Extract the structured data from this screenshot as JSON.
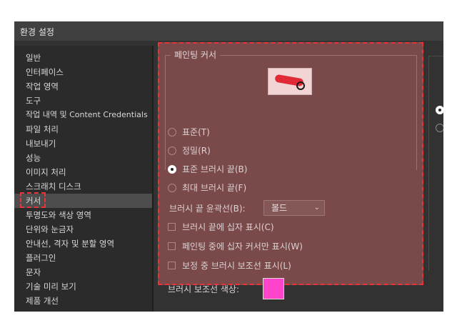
{
  "window": {
    "title": "환경 설정"
  },
  "sidebar": {
    "items": [
      {
        "label": "일반"
      },
      {
        "label": "인터페이스"
      },
      {
        "label": "작업 영역"
      },
      {
        "label": "도구"
      },
      {
        "label": "작업 내역 및 Content Credentials"
      },
      {
        "label": "파일 처리"
      },
      {
        "label": "내보내기"
      },
      {
        "label": "성능"
      },
      {
        "label": "이미지 처리"
      },
      {
        "label": "스크래치 디스크"
      },
      {
        "label": "커서",
        "selected": true
      },
      {
        "label": "투명도와 색상 영역"
      },
      {
        "label": "단위와 눈금자"
      },
      {
        "label": "안내선, 격자 및 분할 영역"
      },
      {
        "label": "플러그인"
      },
      {
        "label": "문자"
      },
      {
        "label": "기술 미리 보기"
      },
      {
        "label": "제품 개선"
      }
    ]
  },
  "painting_cursor": {
    "group_title": "페인팅 커서",
    "options": [
      {
        "label": "표준(T)",
        "checked": false
      },
      {
        "label": "정밀(R)",
        "checked": false
      },
      {
        "label": "표준 브러시 끝(B)",
        "checked": true
      },
      {
        "label": "최대 브러시 끝(F)",
        "checked": false
      }
    ],
    "outline_label": "브러시 끝 윤곽선(B):",
    "outline_value": "볼드",
    "checkboxes": [
      {
        "label": "브러시 끝에 십자 표시(C)",
        "checked": false
      },
      {
        "label": "페인팅 중에 십자 커서만 표시(W)",
        "checked": false
      },
      {
        "label": "보정 중 브러시 보조선 표시(L)",
        "checked": false
      }
    ],
    "guide_color_label": "브러시 보조선 색상:",
    "guide_color": "#ff44cc",
    "preview_icon": "brush-cursor-preview-icon"
  },
  "colors": {
    "highlight": "#e8333a",
    "panel": "#7a4a4b"
  }
}
